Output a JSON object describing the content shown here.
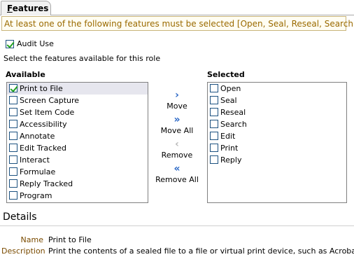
{
  "tab": {
    "label": "Features"
  },
  "message": "At least one of the following features must be selected [Open, Seal, Reseal, Search]",
  "audit": {
    "label": "Audit Use",
    "checked": true
  },
  "instructions": "Select the features available for this role",
  "available": {
    "heading": "Available",
    "items": [
      {
        "label": "Print to File",
        "checked": true,
        "selected": true
      },
      {
        "label": "Screen Capture",
        "checked": false
      },
      {
        "label": "Set Item Code",
        "checked": false
      },
      {
        "label": "Accessibility",
        "checked": false
      },
      {
        "label": "Annotate",
        "checked": false
      },
      {
        "label": "Edit Tracked",
        "checked": false
      },
      {
        "label": "Interact",
        "checked": false
      },
      {
        "label": "Formulae",
        "checked": false
      },
      {
        "label": "Reply Tracked",
        "checked": false
      },
      {
        "label": "Program",
        "checked": false
      }
    ]
  },
  "selected": {
    "heading": "Selected",
    "items": [
      {
        "label": "Open",
        "checked": false
      },
      {
        "label": "Seal",
        "checked": false
      },
      {
        "label": "Reseal",
        "checked": false
      },
      {
        "label": "Search",
        "checked": false
      },
      {
        "label": "Edit",
        "checked": false
      },
      {
        "label": "Print",
        "checked": false
      },
      {
        "label": "Reply",
        "checked": false
      }
    ]
  },
  "buttons": {
    "move": {
      "label": "Move",
      "icon": "chevron-right-icon"
    },
    "move_all": {
      "label": "Move All",
      "icon": "double-chevron-right-icon"
    },
    "remove": {
      "label": "Remove",
      "icon": "chevron-left-icon",
      "disabled": true
    },
    "remove_all": {
      "label": "Remove All",
      "icon": "double-chevron-left-icon"
    }
  },
  "details": {
    "heading": "Details",
    "name_label": "Name",
    "name_value": "Print to File",
    "description_label": "Description",
    "description_value": "Print the contents of a sealed file to a file or virtual print device, such as Acrobat"
  },
  "colors": {
    "accent": "#2a67c6",
    "message_text": "#9a6a00",
    "detail_label": "#7a4b00",
    "check": "#21a121"
  }
}
